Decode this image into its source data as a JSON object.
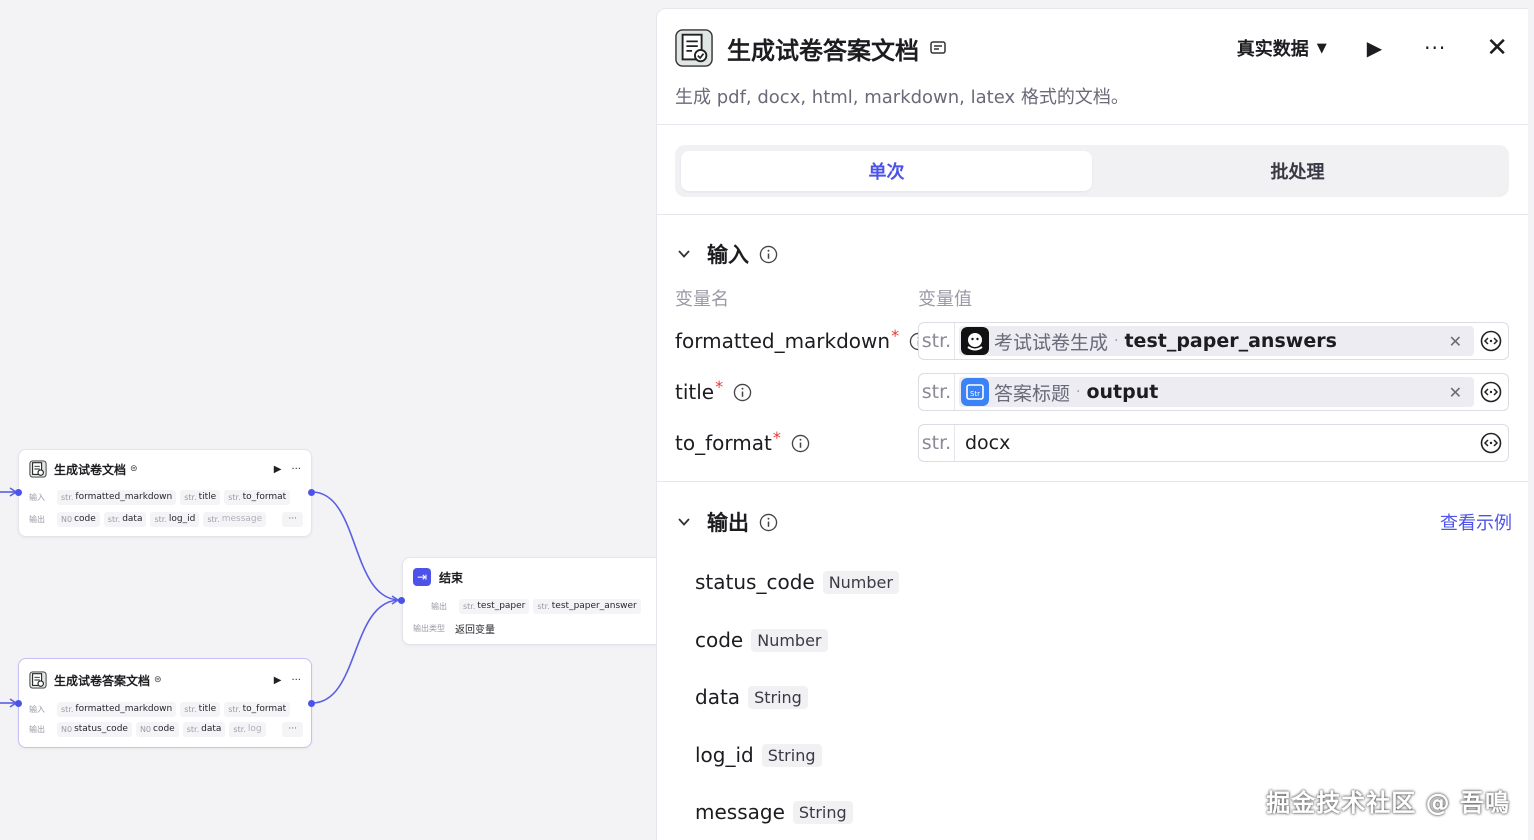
{
  "canvas": {
    "node1": {
      "title": "生成试卷文档",
      "inputs_label": "输入",
      "outputs_label": "输出",
      "inputs": [
        {
          "type": "str.",
          "name": "formatted_markdown"
        },
        {
          "type": "str.",
          "name": "title"
        },
        {
          "type": "str.",
          "name": "to_format"
        }
      ],
      "outputs": [
        {
          "type": "N0",
          "name": "code"
        },
        {
          "type": "str.",
          "name": "data"
        },
        {
          "type": "str.",
          "name": "log_id"
        },
        {
          "type": "str.",
          "name": "message"
        }
      ],
      "more": "···"
    },
    "node2": {
      "title": "生成试卷答案文档",
      "inputs_label": "输入",
      "outputs_label": "输出",
      "inputs": [
        {
          "type": "str.",
          "name": "formatted_markdown"
        },
        {
          "type": "str.",
          "name": "title"
        },
        {
          "type": "str.",
          "name": "to_format"
        }
      ],
      "outputs": [
        {
          "type": "N0",
          "name": "status_code"
        },
        {
          "type": "N0",
          "name": "code"
        },
        {
          "type": "str.",
          "name": "data"
        },
        {
          "type": "str.",
          "name": "log"
        }
      ],
      "more": "···"
    },
    "end": {
      "title": "结束",
      "outputs_label": "输出",
      "outputs": [
        {
          "type": "str.",
          "name": "test_paper"
        },
        {
          "type": "str.",
          "name": "test_paper_answer"
        }
      ],
      "output_type_label": "输出类型",
      "output_type_value": "返回变量"
    }
  },
  "panel": {
    "title": "生成试卷答案文档",
    "description": "生成 pdf, docx, html, markdown, latex 格式的文档。",
    "mode": "真实数据",
    "tabs": [
      "单次",
      "批处理"
    ],
    "input_section": "输入",
    "col_name": "变量名",
    "col_value": "变量值",
    "inputs": [
      {
        "name": "formatted_markdown",
        "type": "str.",
        "ref_node": "考试试卷生成",
        "ref_var": "test_paper_answers"
      },
      {
        "name": "title",
        "type": "str.",
        "ref_node": "答案标题",
        "ref_var": "output"
      },
      {
        "name": "to_format",
        "type": "str.",
        "value": "docx"
      }
    ],
    "output_section": "输出",
    "example_link": "查看示例",
    "outputs": [
      {
        "name": "status_code",
        "type": "Number"
      },
      {
        "name": "code",
        "type": "Number"
      },
      {
        "name": "data",
        "type": "String"
      },
      {
        "name": "log_id",
        "type": "String"
      },
      {
        "name": "message",
        "type": "String"
      }
    ]
  },
  "watermark": "掘金技术社区 @ 吾鳴",
  "colors": {
    "accent": "#4d53e8",
    "required": "#e53935"
  }
}
